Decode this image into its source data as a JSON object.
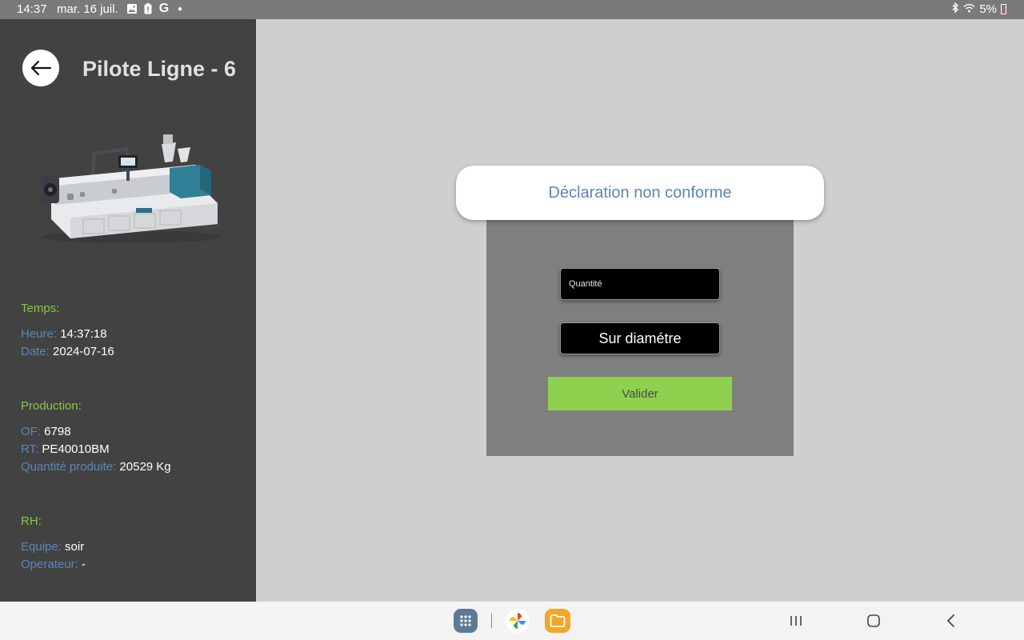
{
  "status_bar": {
    "time": "14:37",
    "date": "mar. 16 juil.",
    "battery": "5%",
    "icons": [
      "gallery-icon",
      "battery-alert-icon",
      "google-icon",
      "dot-icon",
      "bluetooth-icon",
      "wifi-icon",
      "battery-icon"
    ]
  },
  "header": {
    "title": "Pilote Ligne - 6"
  },
  "temps": {
    "title": "Temps:",
    "heure_label": "Heure:",
    "heure_value": "14:37:18",
    "date_label": "Date:",
    "date_value": "2024-07-16"
  },
  "production": {
    "title": "Production:",
    "of_label": "OF:",
    "of_value": "6798",
    "rt_label": "RT:",
    "rt_value": "PE40010BM",
    "qty_label": "Quantité produite:",
    "qty_value": "20529 Kg"
  },
  "rh": {
    "title": "RH:",
    "equipe_label": "Equipe:",
    "equipe_value": "soir",
    "operateur_label": "Operateur:",
    "operateur_value": "-"
  },
  "dialog": {
    "title": "Déclaration non conforme",
    "quantity_placeholder": "Quantité",
    "defect_selected": "Sur diamétre",
    "validate_label": "Valider"
  },
  "colors": {
    "sidebar_bg": "#424242",
    "accent_green": "#8bc34a",
    "label_blue": "#5e86b5",
    "validate_green": "#8fd14f"
  }
}
